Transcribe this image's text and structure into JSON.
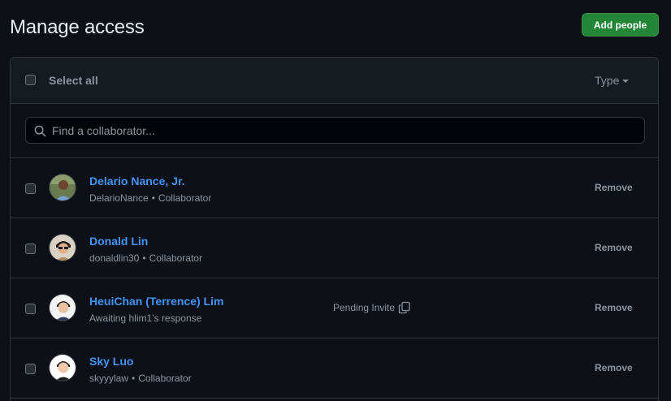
{
  "header": {
    "title": "Manage access",
    "add_button_label": "Add people"
  },
  "toolbar": {
    "select_all_label": "Select all",
    "type_filter_label": "Type"
  },
  "search": {
    "placeholder": "Find a collaborator...",
    "value": ""
  },
  "colors": {
    "accent_green": "#238636",
    "link_blue": "#4493f8",
    "background": "#0d1117"
  },
  "members": [
    {
      "name": "Delario Nance, Jr.",
      "username": "DelarioNance",
      "separator": "•",
      "role": "Collaborator",
      "status": "",
      "action": "Remove"
    },
    {
      "name": "Donald Lin",
      "username": "donaldlin30",
      "separator": "•",
      "role": "Collaborator",
      "status": "",
      "action": "Remove"
    },
    {
      "name": "HeuiChan (Terrence) Lim",
      "subtitle": "Awaiting hlim1’s response",
      "status": "Pending Invite",
      "action": "Remove"
    },
    {
      "name": "Sky Luo",
      "username": "skyyylaw",
      "separator": "•",
      "role": "Collaborator",
      "status": "",
      "action": "Remove"
    }
  ]
}
